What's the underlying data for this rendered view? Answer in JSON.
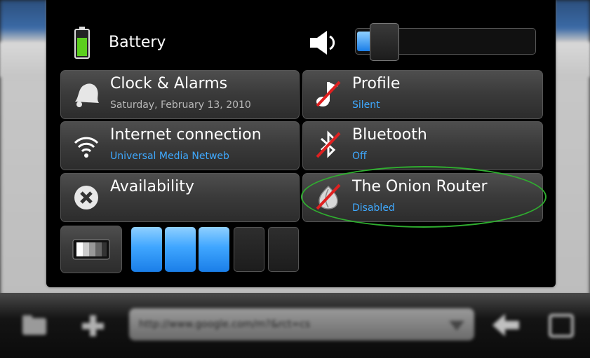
{
  "status_menu": {
    "battery": {
      "label": "Battery"
    },
    "volume": {
      "level": 0.08
    },
    "clock": {
      "title": "Clock & Alarms",
      "subtitle": "Saturday, February 13, 2010"
    },
    "profile": {
      "title": "Profile",
      "subtitle": "Silent"
    },
    "internet": {
      "title": "Internet connection",
      "subtitle": "Universal Media Netweb"
    },
    "bluetooth": {
      "title": "Bluetooth",
      "subtitle": "Off"
    },
    "availability": {
      "title": "Availability"
    },
    "tor": {
      "title": "The Onion Router",
      "subtitle": "Disabled"
    },
    "brightness": {
      "level_segments": 3,
      "total_segments": 5
    }
  },
  "browser_bar": {
    "url": "http://www.google.com/m?&rct=cs",
    "icons": [
      "folder-icon",
      "add-bookmark-icon",
      "dropdown-icon",
      "back-icon",
      "fullscreen-icon"
    ]
  },
  "colors": {
    "accent": "#3fa9ff",
    "highlight_ellipse": "#2fae2f",
    "battery_green": "#5ccf1e"
  }
}
